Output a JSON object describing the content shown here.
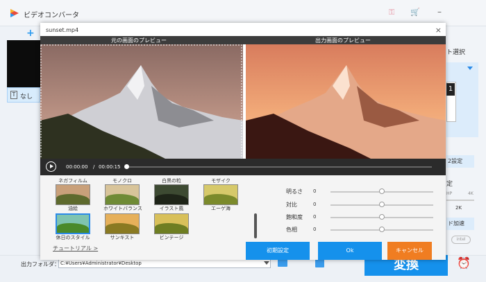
{
  "app": {
    "title": "ビデオコンバータ"
  },
  "sidebar": {
    "add_icon": "plus-icon",
    "item_label": "なし",
    "item_icon": "T"
  },
  "right_panel": {
    "format_label": "ト選択",
    "format_number": "1",
    "settings_label": "2設定",
    "resolution_label": "定",
    "res_low": "HP",
    "res_high": "4K",
    "res_value": "2K",
    "accel_label": "ド加速",
    "intel_label": "intel"
  },
  "bottom": {
    "output_label": "出力フォルダ：",
    "output_path": "C:¥Users¥Administrator¥Desktop",
    "convert_label": "変換"
  },
  "dialog": {
    "title": "sunset.mp4",
    "close": "×",
    "preview_left_label": "元の画面のプレビュー",
    "preview_right_label": "出力画面のプレビュー",
    "time_current": "00:00:00",
    "time_sep": "/",
    "time_total": "00:00:15",
    "playback_progress": 0.0,
    "tutorial": "チュートリアル >",
    "buttons": {
      "reset": "初期設定",
      "ok": "Ok",
      "cancel": "キャンセル"
    }
  },
  "filters": {
    "row_top_labels": [
      "ネガフィルム",
      "モノクロ",
      "白黒の粒",
      "モザイク"
    ],
    "row1": [
      {
        "label": "油絵",
        "selected": false
      },
      {
        "label": "ホワイトバランス",
        "selected": false
      },
      {
        "label": "イラスト風",
        "selected": false
      },
      {
        "label": "エーゲ海",
        "selected": false
      }
    ],
    "row2": [
      {
        "label": "休日のスタイル",
        "selected": true
      },
      {
        "label": "サンキスト",
        "selected": false
      },
      {
        "label": "ビンテージ",
        "selected": false
      }
    ]
  },
  "adjustments": [
    {
      "label": "明るさ",
      "value": "0",
      "level": 0.5
    },
    {
      "label": "対比",
      "value": "0",
      "level": 0.5
    },
    {
      "label": "飽和度",
      "value": "0",
      "level": 0.5
    },
    {
      "label": "色相",
      "value": "0",
      "level": 0.5
    }
  ],
  "colors": {
    "accent": "#1591ec",
    "cancel": "#f07d21",
    "filter_selected": "#2a8ae8"
  }
}
